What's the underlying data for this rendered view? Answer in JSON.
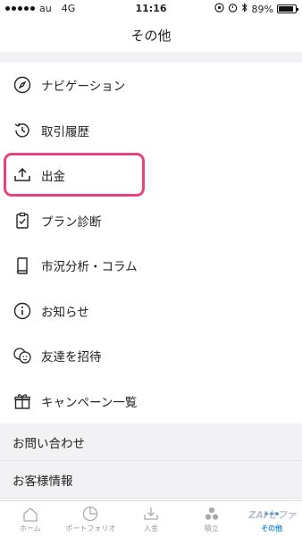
{
  "status_bar": {
    "carrier": "au",
    "network": "4G",
    "time": "11:16",
    "battery": "89%"
  },
  "header": {
    "title": "その他"
  },
  "menu": {
    "items": [
      {
        "label": "ナビゲーション",
        "icon": "compass-icon"
      },
      {
        "label": "取引履歴",
        "icon": "history-icon"
      },
      {
        "label": "出金",
        "icon": "upload-icon"
      },
      {
        "label": "プラン診断",
        "icon": "clipboard-check-icon"
      },
      {
        "label": "市況分析・コラム",
        "icon": "book-icon"
      },
      {
        "label": "お知らせ",
        "icon": "info-icon"
      },
      {
        "label": "友達を招待",
        "icon": "friends-icon"
      },
      {
        "label": "キャンペーン一覧",
        "icon": "gift-icon"
      }
    ]
  },
  "section": {
    "items": [
      {
        "label": "お問い合わせ"
      },
      {
        "label": "お客様情報"
      }
    ]
  },
  "tabs": [
    {
      "label": "ホーム",
      "icon": "home-icon"
    },
    {
      "label": "ポートフォリオ",
      "icon": "portfolio-icon"
    },
    {
      "label": "入金",
      "icon": "download-icon"
    },
    {
      "label": "積立",
      "icon": "coins-icon"
    },
    {
      "label": "その他",
      "icon": "more-icon",
      "active": true
    }
  ],
  "colors": {
    "highlight": "#e8437a",
    "accent": "#2a8fd6"
  }
}
